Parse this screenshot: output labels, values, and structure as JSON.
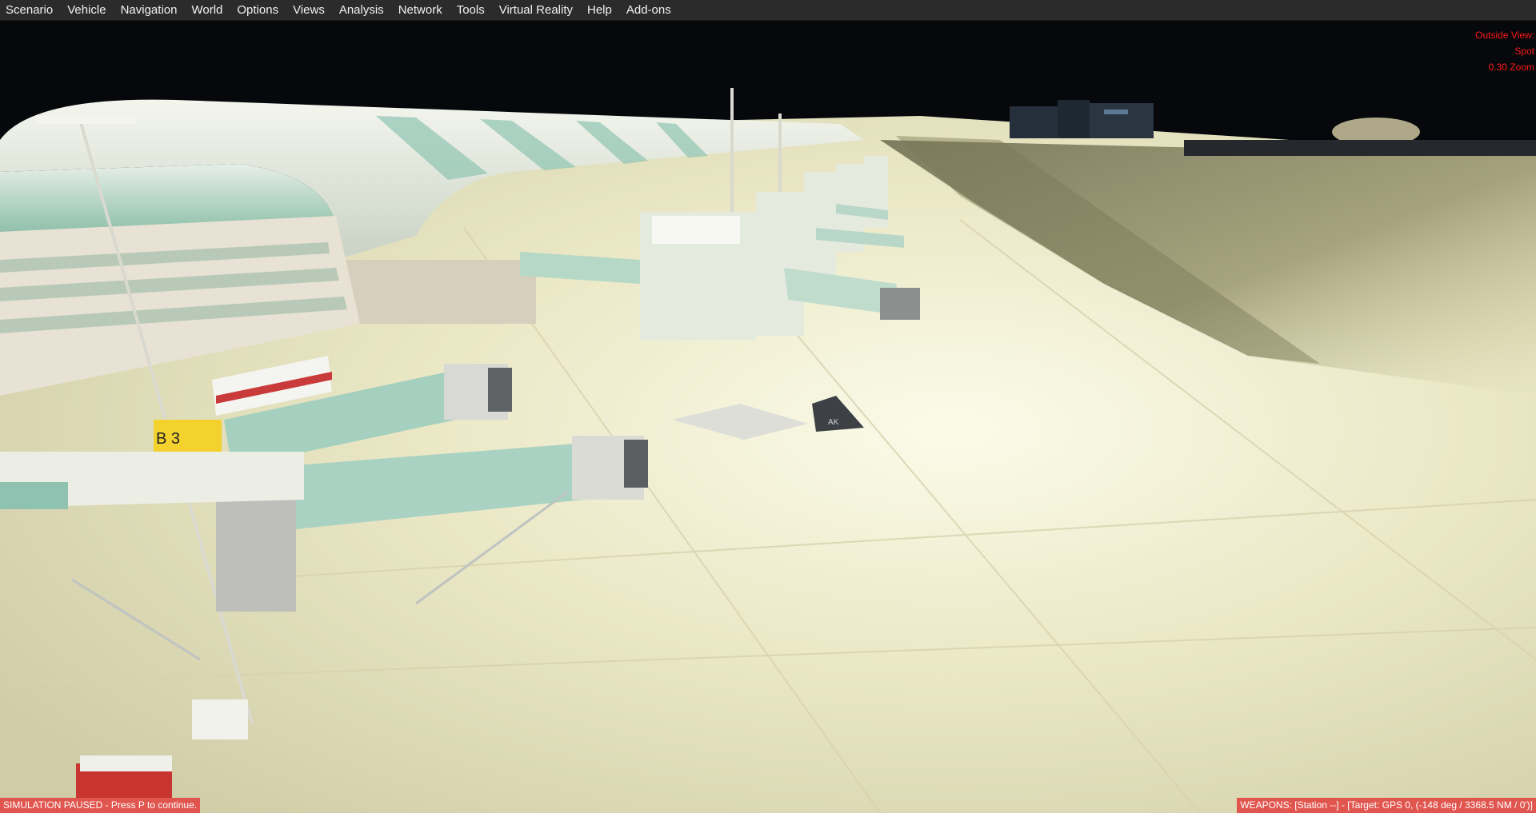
{
  "menu": {
    "items": [
      {
        "label": "Scenario",
        "name": "menu-scenario"
      },
      {
        "label": "Vehicle",
        "name": "menu-vehicle"
      },
      {
        "label": "Navigation",
        "name": "menu-navigation"
      },
      {
        "label": "World",
        "name": "menu-world"
      },
      {
        "label": "Options",
        "name": "menu-options"
      },
      {
        "label": "Views",
        "name": "menu-views"
      },
      {
        "label": "Analysis",
        "name": "menu-analysis"
      },
      {
        "label": "Network",
        "name": "menu-network"
      },
      {
        "label": "Tools",
        "name": "menu-tools"
      },
      {
        "label": "Virtual Reality",
        "name": "menu-virtual-reality"
      },
      {
        "label": "Help",
        "name": "menu-help"
      },
      {
        "label": "Add-ons",
        "name": "menu-add-ons"
      }
    ]
  },
  "view_info": {
    "line1": "Outside View:",
    "line2": "Spot",
    "line3": "0.30 Zoom"
  },
  "status": {
    "paused": "SIMULATION PAUSED - Press P to continue.",
    "weapons": "WEAPONS: [Station --] - [Target: GPS 0, (-148 deg / 3368.5 NM / 0')]"
  },
  "scene": {
    "gate_sign": "B 3",
    "tail_code": "AK"
  },
  "colors": {
    "menubar_bg": "#2b2b2b",
    "status_bg": "#e0564f",
    "view_info_text": "#ff1a1a",
    "apron": "#e9e6c4",
    "night_sky": "#05070a"
  }
}
